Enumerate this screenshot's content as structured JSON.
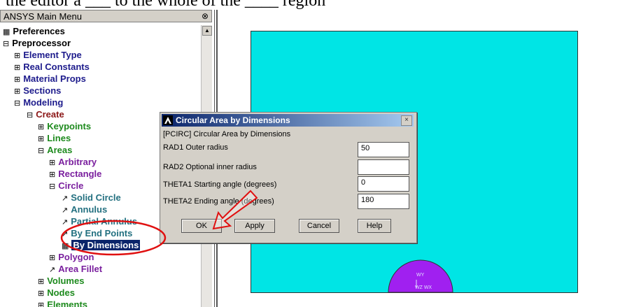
{
  "caption": "the editor a ___ to the whole of the ____ region",
  "menu": {
    "title": "ANSYS Main Menu",
    "collapse_glyph": "⊗",
    "items": [
      {
        "label": "Preferences",
        "glyph": "▦"
      },
      {
        "label": "Preprocessor",
        "glyph": "⊟"
      },
      {
        "label": "Element Type",
        "glyph": "⊞"
      },
      {
        "label": "Real Constants",
        "glyph": "⊞"
      },
      {
        "label": "Material Props",
        "glyph": "⊞"
      },
      {
        "label": "Sections",
        "glyph": "⊞"
      },
      {
        "label": "Modeling",
        "glyph": "⊟"
      },
      {
        "label": "Create",
        "glyph": "⊟"
      },
      {
        "label": "Keypoints",
        "glyph": "⊞"
      },
      {
        "label": "Lines",
        "glyph": "⊞"
      },
      {
        "label": "Areas",
        "glyph": "⊟"
      },
      {
        "label": "Arbitrary",
        "glyph": "⊞"
      },
      {
        "label": "Rectangle",
        "glyph": "⊞"
      },
      {
        "label": "Circle",
        "glyph": "⊟"
      },
      {
        "label": "Solid Circle",
        "glyph": "↗"
      },
      {
        "label": "Annulus",
        "glyph": "↗"
      },
      {
        "label": "Partial Annulus",
        "glyph": "↗"
      },
      {
        "label": "By End Points",
        "glyph": "↗"
      },
      {
        "label": "By Dimensions",
        "glyph": "▦"
      },
      {
        "label": "Polygon",
        "glyph": "⊞"
      },
      {
        "label": "Area Fillet",
        "glyph": "↗"
      },
      {
        "label": "Volumes",
        "glyph": "⊞"
      },
      {
        "label": "Nodes",
        "glyph": "⊞"
      },
      {
        "label": "Elements",
        "glyph": "⊞"
      }
    ]
  },
  "dialog": {
    "title": "Circular Area by Dimensions",
    "command": "[PCIRC]  Circular Area by Dimensions",
    "rows": [
      {
        "label": "RAD1   Outer radius",
        "value": "50"
      },
      {
        "label": "RAD2   Optional inner radius",
        "value": ""
      },
      {
        "label": "THETA1  Starting angle (degrees)",
        "value": "0"
      },
      {
        "label": "THETA2  Ending angle (degrees)",
        "value": "180"
      }
    ],
    "buttons": {
      "ok": "OK",
      "apply": "Apply",
      "cancel": "Cancel",
      "help": "Help"
    },
    "close_glyph": "×"
  },
  "model": {
    "triad_labels": [
      "WY",
      "WZ WX"
    ],
    "background_color": "#00e5e5",
    "area_color": "#a020f0"
  },
  "annotation_color": "#e01010"
}
